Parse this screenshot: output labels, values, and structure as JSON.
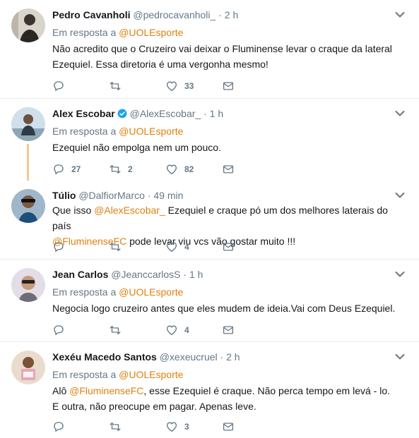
{
  "tweets": [
    {
      "name": "Pedro Cavanholi",
      "handle": "@pedrocavanholi_",
      "dot": "·",
      "time": "2 h",
      "reply_prefix": "Em resposta a",
      "reply_to": "@UOLEsporte",
      "text_lines": [
        "Não acredito que o Cruzeiro vai deixar o Fluminense levar o craque da lateral",
        "Ezequiel. Essa diretoria é uma vergonha mesmo!"
      ],
      "replies": "",
      "retweets": "",
      "likes": "33"
    },
    {
      "name": "Alex Escobar",
      "handle": "@AlexEscobar_",
      "dot": "·",
      "time": "1 h",
      "verified": true,
      "reply_prefix": "Em resposta a",
      "reply_to": "@UOLEsporte",
      "text_lines": [
        "Ezequiel não empolga nem um pouco."
      ],
      "replies": "27",
      "retweets": "2",
      "likes": "82"
    },
    {
      "name": "Túlio",
      "handle": "@DalfiorMarco",
      "dot": "·",
      "time": "49 min",
      "text_line1_prefix": "Que isso ",
      "text_line1_mention": "@AlexEscobar_",
      "text_line1_rest": " Ezequiel e craque pó um dos melhores laterais do país",
      "text_line2_mention": "@FluminenseFC",
      "text_line2_rest": " pode levar viu vcs vão gostar muito !!!",
      "replies": "",
      "retweets": "",
      "likes": "4"
    },
    {
      "name": "Jean Carlos",
      "handle": "@JeanccarlosS",
      "dot": "·",
      "time": "1 h",
      "reply_prefix": "Em resposta a",
      "reply_to": "@UOLEsporte",
      "text_lines": [
        "Negocia logo cruzeiro antes que eles mudem de ideia.Vai com Deus Ezequiel."
      ],
      "replies": "",
      "retweets": "",
      "likes": "4"
    },
    {
      "name": "Xexéu Macedo Santos",
      "handle": "@xexeucruel",
      "dot": "·",
      "time": "2 h",
      "reply_prefix": "Em resposta a",
      "reply_to": "@UOLEsporte",
      "text_line1_prefix": "Alô ",
      "text_line1_mention": "@FluminenseFC",
      "text_line1_rest": ", esse Ezequiel é craque. Não perca tempo em levá - lo.",
      "text_line2": "E outra, não preocupe em pagar. Apenas leve.",
      "replies": "",
      "retweets": "",
      "likes": "3"
    }
  ],
  "colors": {
    "accent": "#e0810f",
    "muted": "#657786",
    "verified": "#1da1f2",
    "thread_line": "#f5c88f",
    "divider": "#e6ecf0"
  },
  "icons": {
    "reply": "reply-icon",
    "retweet": "retweet-icon",
    "like": "heart-icon",
    "dm": "envelope-icon",
    "menu": "chevron-down-icon",
    "verified": "verified-badge-icon"
  }
}
